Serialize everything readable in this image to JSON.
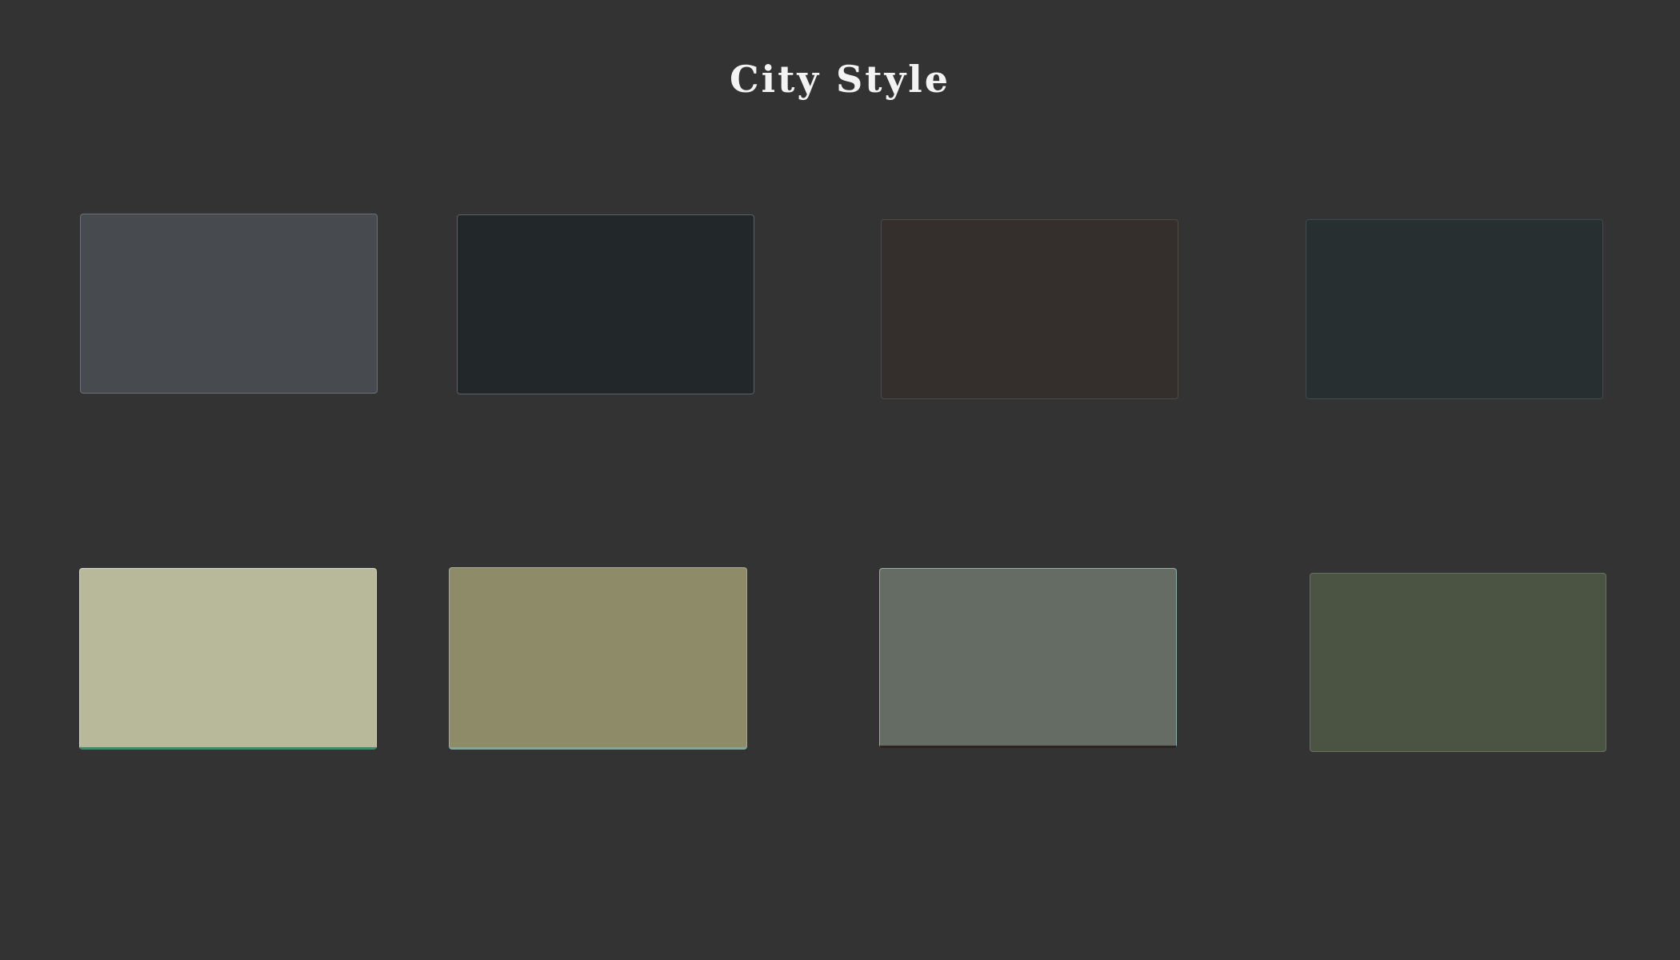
{
  "page": {
    "title": "City Style",
    "background": "#333333"
  },
  "swatches": [
    {
      "color": "#474b4f"
    },
    {
      "color": "#22272a"
    },
    {
      "color": "#342e2c"
    },
    {
      "color": "#272f31"
    },
    {
      "color": "#b8b89a"
    },
    {
      "color": "#8d8b68"
    },
    {
      "color": "#646c63"
    },
    {
      "color": "#4b5443"
    }
  ]
}
